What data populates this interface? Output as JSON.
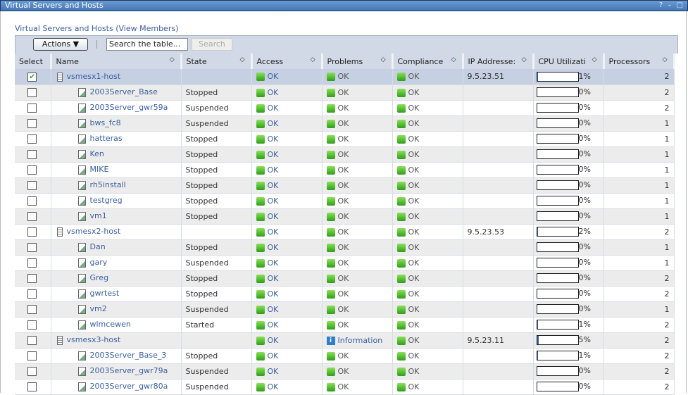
{
  "window": {
    "title": "Virtual Servers and Hosts",
    "icons": "? – □"
  },
  "subtitle": "Virtual Servers and Hosts (View Members)",
  "toolbar": {
    "actions": "Actions ▼",
    "search_placeholder": "Search the table...",
    "search_button": "Search"
  },
  "columns": [
    "Select",
    "Name",
    "State",
    "Access",
    "Problems",
    "Compliance",
    "IP Addresse:",
    "CPU Utilizati",
    "Processors"
  ],
  "rows": [
    {
      "sel": true,
      "host": true,
      "name": "vsmesx1-host",
      "state": "",
      "access": "OK",
      "problems": "OK",
      "compliance": "OK",
      "ip": "9.5.23.51",
      "cpu": 1,
      "proc": "2"
    },
    {
      "name": "2003Server_Base",
      "state": "Stopped",
      "access": "OK",
      "problems": "OK",
      "compliance": "OK",
      "ip": "",
      "cpu": 0,
      "proc": "2"
    },
    {
      "name": "2003Server_gwr59a",
      "state": "Suspended",
      "access": "OK",
      "problems": "OK",
      "compliance": "OK",
      "ip": "",
      "cpu": 0,
      "proc": "2"
    },
    {
      "name": "bws_fc8",
      "state": "Suspended",
      "access": "OK",
      "problems": "OK",
      "compliance": "OK",
      "ip": "",
      "cpu": 0,
      "proc": "1"
    },
    {
      "name": "hatteras",
      "state": "Stopped",
      "access": "OK",
      "problems": "OK",
      "compliance": "OK",
      "ip": "",
      "cpu": 0,
      "proc": "1"
    },
    {
      "name": "Ken",
      "state": "Stopped",
      "access": "OK",
      "problems": "OK",
      "compliance": "OK",
      "ip": "",
      "cpu": 0,
      "proc": "1"
    },
    {
      "name": "MIKE",
      "state": "Stopped",
      "access": "OK",
      "problems": "OK",
      "compliance": "OK",
      "ip": "",
      "cpu": 0,
      "proc": "1"
    },
    {
      "name": "rh5install",
      "state": "Stopped",
      "access": "OK",
      "problems": "OK",
      "compliance": "OK",
      "ip": "",
      "cpu": 0,
      "proc": "1"
    },
    {
      "name": "testgreg",
      "state": "Stopped",
      "access": "OK",
      "problems": "OK",
      "compliance": "OK",
      "ip": "",
      "cpu": 0,
      "proc": "1"
    },
    {
      "name": "vm1",
      "state": "Stopped",
      "access": "OK",
      "problems": "OK",
      "compliance": "OK",
      "ip": "",
      "cpu": 0,
      "proc": "1"
    },
    {
      "host": true,
      "name": "vsmesx2-host",
      "state": "",
      "access": "OK",
      "problems": "OK",
      "compliance": "OK",
      "ip": "9.5.23.53",
      "cpu": 2,
      "proc": "2"
    },
    {
      "name": "Dan",
      "state": "Stopped",
      "access": "OK",
      "problems": "OK",
      "compliance": "OK",
      "ip": "",
      "cpu": 0,
      "proc": "1"
    },
    {
      "name": "gary",
      "state": "Suspended",
      "access": "OK",
      "problems": "OK",
      "compliance": "OK",
      "ip": "",
      "cpu": 0,
      "proc": "1"
    },
    {
      "name": "Greg",
      "state": "Stopped",
      "access": "OK",
      "problems": "OK",
      "compliance": "OK",
      "ip": "",
      "cpu": 0,
      "proc": "2"
    },
    {
      "name": "gwrtest",
      "state": "Stopped",
      "access": "OK",
      "problems": "OK",
      "compliance": "OK",
      "ip": "",
      "cpu": 0,
      "proc": "2"
    },
    {
      "name": "vm2",
      "state": "Suspended",
      "access": "OK",
      "problems": "OK",
      "compliance": "OK",
      "ip": "",
      "cpu": 0,
      "proc": "1"
    },
    {
      "name": "wlmcewen",
      "state": "Started",
      "access": "OK",
      "problems": "OK",
      "compliance": "OK",
      "ip": "",
      "cpu": 1,
      "proc": "2"
    },
    {
      "host": true,
      "name": "vsmesx3-host",
      "state": "",
      "access": "OK",
      "problems": "Information",
      "problems_info": true,
      "compliance": "OK",
      "ip": "9.5.23.11",
      "cpu": 5,
      "proc": "2"
    },
    {
      "name": "2003Server_Base_3",
      "state": "Stopped",
      "access": "OK",
      "problems": "OK",
      "compliance": "OK",
      "ip": "",
      "cpu": 1,
      "proc": "2"
    },
    {
      "name": "2003Server_gwr79a",
      "state": "Suspended",
      "access": "OK",
      "problems": "OK",
      "compliance": "OK",
      "ip": "",
      "cpu": 0,
      "proc": "2"
    },
    {
      "name": "2003Server_gwr80a",
      "state": "Suspended",
      "access": "OK",
      "problems": "OK",
      "compliance": "OK",
      "ip": "",
      "cpu": 0,
      "proc": "2"
    }
  ]
}
